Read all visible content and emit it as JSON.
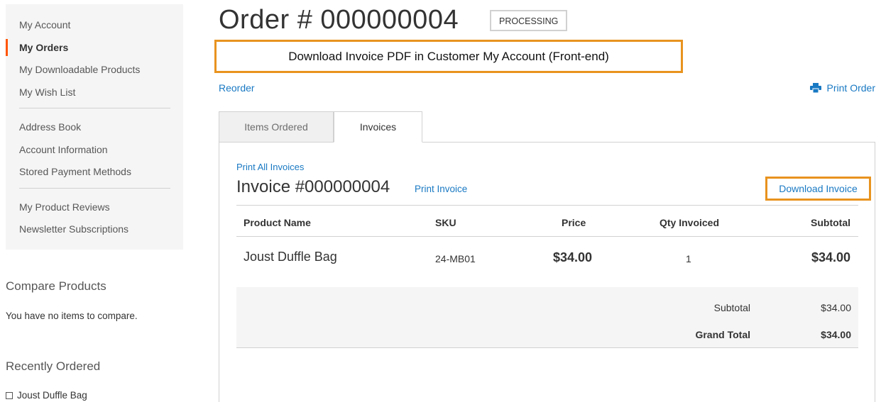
{
  "sidebar": {
    "items": [
      {
        "label": "My Account"
      },
      {
        "label": "My Orders"
      },
      {
        "label": "My Downloadable Products"
      },
      {
        "label": "My Wish List"
      },
      {
        "label": "Address Book"
      },
      {
        "label": "Account Information"
      },
      {
        "label": "Stored Payment Methods"
      },
      {
        "label": "My Product Reviews"
      },
      {
        "label": "Newsletter Subscriptions"
      }
    ],
    "compare_title": "Compare Products",
    "compare_text": "You have no items to compare.",
    "recent_title": "Recently Ordered",
    "recent_item": "Joust Duffle Bag"
  },
  "order": {
    "title": "Order # 000000004",
    "status": "PROCESSING",
    "annotation": "Download Invoice PDF in Customer My Account (Front-end)",
    "reorder_label": "Reorder",
    "print_order_label": "Print Order"
  },
  "tabs": [
    {
      "label": "Items Ordered"
    },
    {
      "label": "Invoices"
    }
  ],
  "invoice": {
    "print_all_label": "Print All Invoices",
    "title": "Invoice #000000004",
    "print_invoice_label": "Print Invoice",
    "download_label": "Download Invoice",
    "columns": [
      "Product Name",
      "SKU",
      "Price",
      "Qty Invoiced",
      "Subtotal"
    ],
    "rows": [
      {
        "name": "Joust Duffle Bag",
        "sku": "24-MB01",
        "price": "$34.00",
        "qty": "1",
        "subtotal": "$34.00"
      }
    ],
    "totals": {
      "subtotal_label": "Subtotal",
      "subtotal_value": "$34.00",
      "grand_total_label": "Grand Total",
      "grand_total_value": "$34.00"
    }
  },
  "colors": {
    "link": "#1979c3",
    "accent": "#ff5501",
    "annotation_border": "#e8931f"
  }
}
